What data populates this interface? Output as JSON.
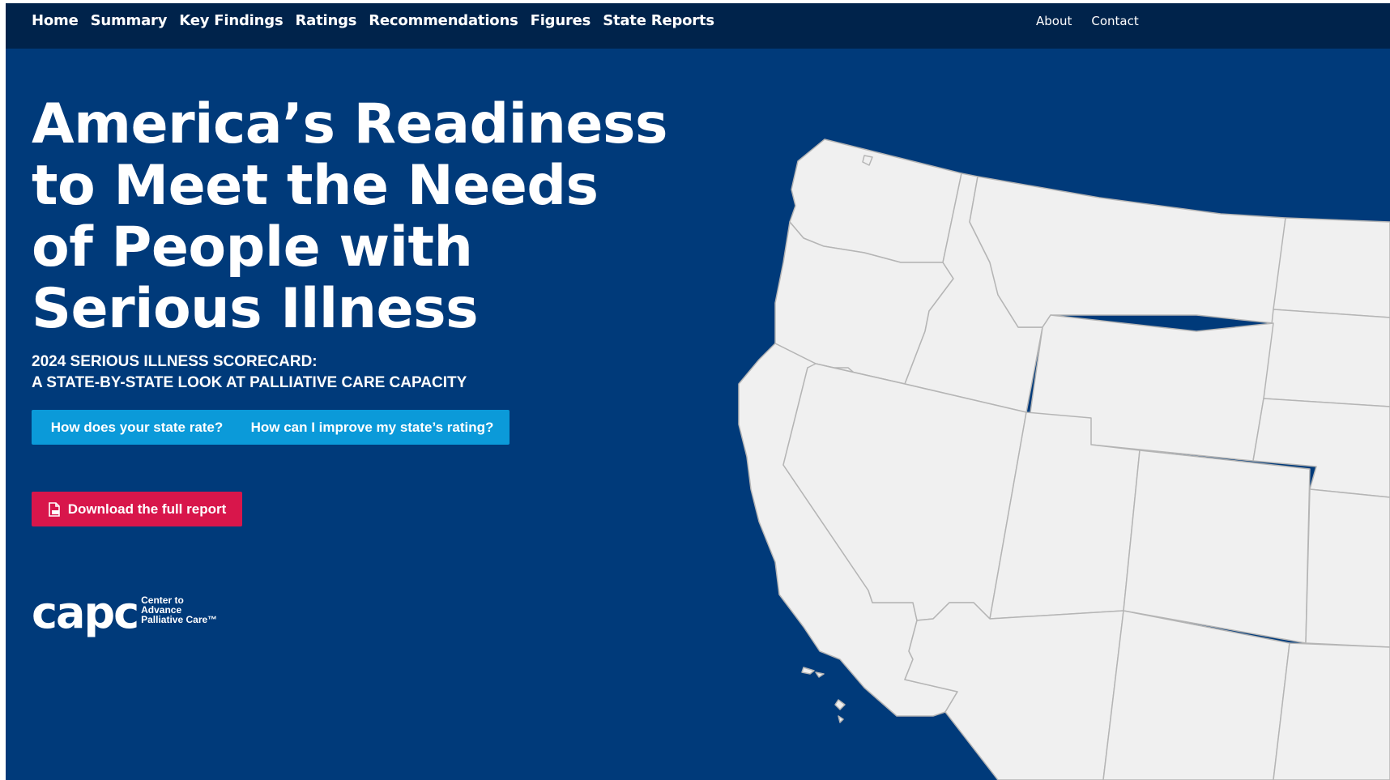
{
  "nav": {
    "items": [
      {
        "label": "Home"
      },
      {
        "label": "Summary"
      },
      {
        "label": "Key Findings"
      },
      {
        "label": "Ratings"
      },
      {
        "label": "Recommendations"
      },
      {
        "label": "Figures"
      },
      {
        "label": "State Reports"
      }
    ],
    "about": "About",
    "contact": "Contact"
  },
  "hero": {
    "title_lines": [
      "America’s Readiness",
      "to Meet the Needs",
      "of People with",
      "Serious Illness"
    ],
    "subtitle_lines": [
      "2024 SERIOUS ILLNESS SCORECARD:",
      "A STATE-BY-STATE LOOK AT PALLIATIVE CARE CAPACITY"
    ]
  },
  "buttons": {
    "rate": "How does your state rate?",
    "improve": "How can I improve my state’s rating?",
    "download": "Download the full report",
    "download_icon": "pdf-file-icon"
  },
  "logo": {
    "mark": "capc",
    "text_lines": [
      "Center to",
      "Advance",
      "Palliative Care™"
    ]
  },
  "colors": {
    "background": "#003a7a",
    "nav_background": "#00234b",
    "button_blue": "#0b9ad9",
    "button_red": "#d8164b",
    "map_fill": "#f0f0f0",
    "map_border": "#b5b5b5"
  }
}
